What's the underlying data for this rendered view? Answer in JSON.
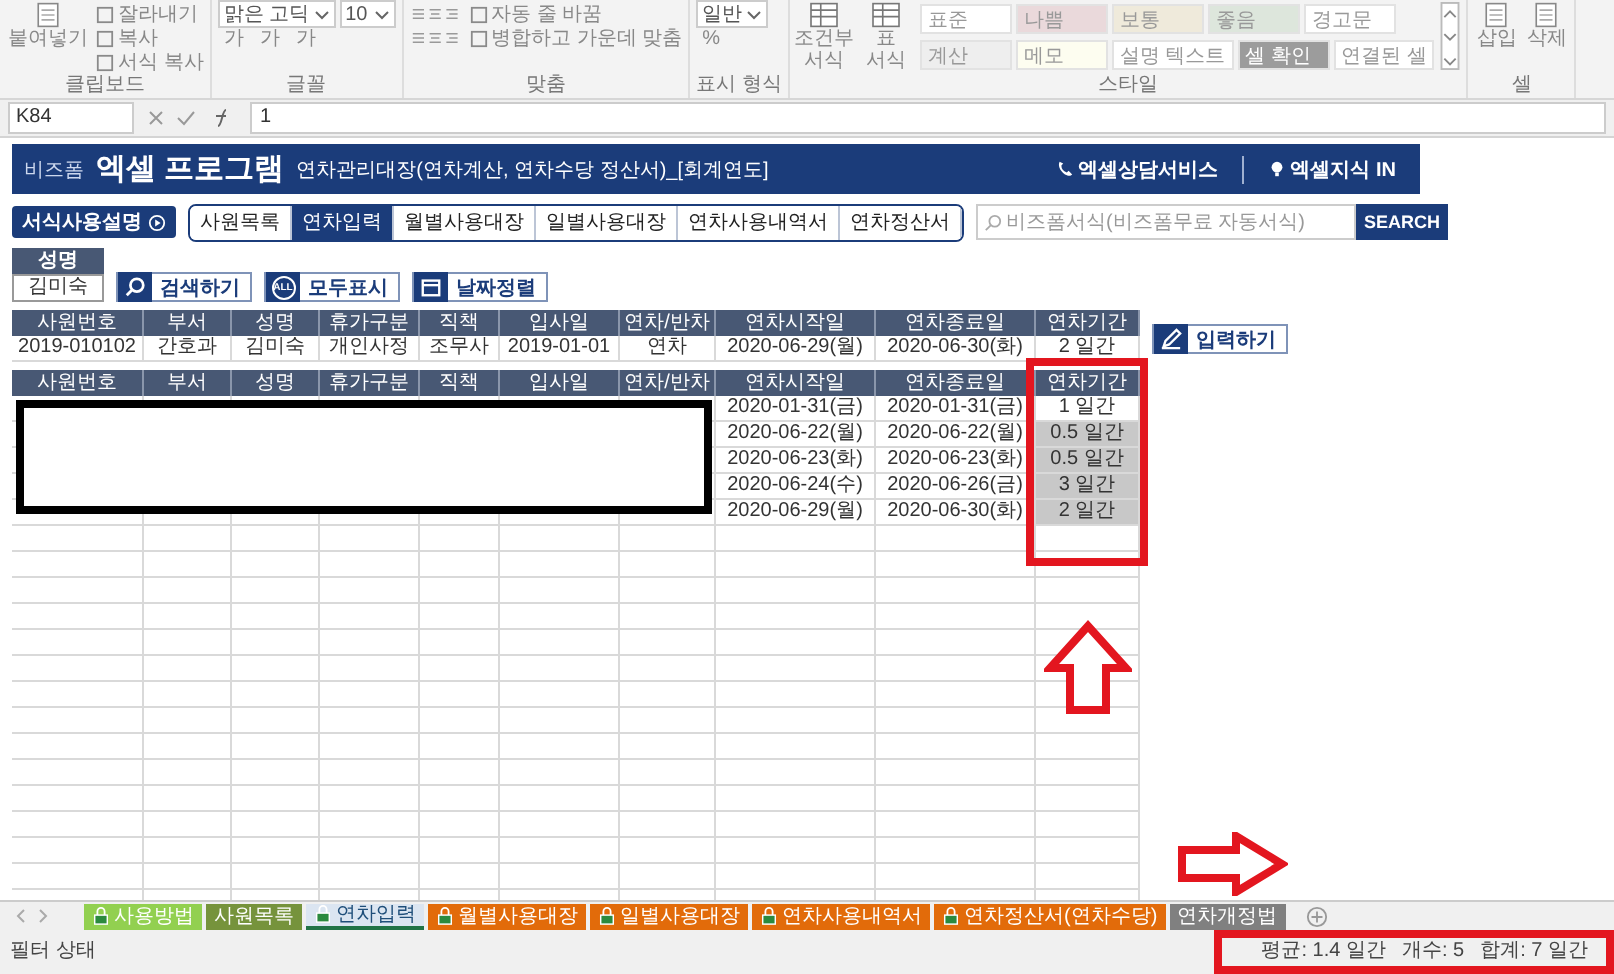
{
  "ribbon": {
    "groups": [
      {
        "label": "클립보드",
        "kind": "clipboard",
        "big": [
          "붙여넣기"
        ],
        "lines": [
          {
            "items": [
              {
                "text": "잘라내기",
                "kind": "text"
              }
            ]
          },
          {
            "items": [
              {
                "text": "복사",
                "kind": "text"
              }
            ]
          },
          {
            "items": [
              {
                "text": "서식 복사",
                "kind": "text"
              }
            ]
          }
        ]
      },
      {
        "label": "글꼴",
        "kind": "font",
        "lines": [
          {
            "items": [
              {
                "text": "맑은 고딕",
                "kind": "dropdown"
              },
              {
                "text": "10",
                "kind": "dropdown"
              }
            ]
          },
          {
            "items": [
              {
                "text": "가",
                "kind": "glyph"
              },
              {
                "text": "가",
                "kind": "glyph"
              },
              {
                "text": "가",
                "kind": "glyph"
              }
            ]
          }
        ]
      },
      {
        "label": "맞춤",
        "kind": "align",
        "lines": [
          {
            "items": [
              {
                "text": "자동 줄 바꿈",
                "kind": "text"
              }
            ]
          },
          {
            "items": [
              {
                "text": "병합하고 가운데 맞춤",
                "kind": "text"
              }
            ]
          }
        ]
      },
      {
        "label": "표시 형식",
        "kind": "number",
        "lines": [
          {
            "items": [
              {
                "text": "일반",
                "kind": "dropdown"
              }
            ]
          },
          {
            "items": [
              {
                "text": "%",
                "kind": "glyph"
              }
            ]
          }
        ]
      },
      {
        "label": "스타일",
        "kind": "styles",
        "big": [
          "조건부 서식",
          "표 서식"
        ],
        "lines": [
          {
            "items": [
              {
                "text": "표준",
                "kind": "style",
                "color": "#ffffff"
              },
              {
                "text": "나쁨",
                "kind": "style",
                "color": "#ead9db"
              },
              {
                "text": "보통",
                "kind": "style",
                "color": "#efeadb"
              },
              {
                "text": "좋음",
                "kind": "style",
                "color": "#dde6dc"
              },
              {
                "text": "경고문",
                "kind": "style",
                "color": "#ffffff"
              }
            ]
          },
          {
            "items": [
              {
                "text": "계산",
                "kind": "style",
                "color": "#eeeeee"
              },
              {
                "text": "메모",
                "kind": "style",
                "color": "#fdfdf0"
              },
              {
                "text": "설명 텍스트",
                "kind": "style",
                "color": "#ffffff"
              },
              {
                "text": "셀 확인",
                "kind": "style",
                "color": "#9c9c9c"
              },
              {
                "text": "연결된 셀",
                "kind": "style",
                "color": "#ffffff"
              }
            ]
          }
        ]
      },
      {
        "label": "셀",
        "kind": "cells",
        "big": [
          "삽입",
          "삭제"
        ]
      }
    ]
  },
  "formula_bar": {
    "cell": "K84",
    "value": "1"
  },
  "banner": {
    "logo": "비즈폼",
    "title": "엑셀 프로그램",
    "subtitle": "연차관리대장(연차계산, 연차수당 정산서)_[회계연도]",
    "links": [
      {
        "text": "엑셀상담서비스",
        "kind": "phone"
      },
      {
        "text": "엑셀지식 IN",
        "kind": "bulb"
      }
    ]
  },
  "help_button": "서식사용설명",
  "tabs": [
    {
      "label": "사원목록",
      "selected": false
    },
    {
      "label": "연차입력",
      "selected": true
    },
    {
      "label": "월별사용대장",
      "selected": false
    },
    {
      "label": "일별사용대장",
      "selected": false
    },
    {
      "label": "연차사용내역서",
      "selected": false
    },
    {
      "label": "연차정산서",
      "selected": false
    }
  ],
  "search": {
    "placeholder": "비즈폼서식(비즈폼무료 자동서식)",
    "button": "SEARCH"
  },
  "name_filter": {
    "label": "성명",
    "value": "김미숙"
  },
  "actions": [
    {
      "label": "검색하기",
      "kind": "search"
    },
    {
      "label": "모두표시",
      "kind": "all",
      "badge": "ALL"
    },
    {
      "label": "날짜정렬",
      "kind": "calendar"
    }
  ],
  "entry_table": {
    "columns": [
      "사원번호",
      "부서",
      "성명",
      "휴가구분",
      "직책",
      "입사일",
      "연차/반차",
      "연차시작일",
      "연차종료일",
      "연차기간"
    ],
    "row": [
      "2019-010102",
      "간호과",
      "김미숙",
      "개인사정",
      "조무사",
      "2019-01-01",
      "연차",
      "2020-06-29(월)",
      "2020-06-30(화)",
      "2 일간"
    ]
  },
  "input_button": "입력하기",
  "log_table": {
    "columns": [
      "사원번호",
      "부서",
      "성명",
      "휴가구분",
      "직책",
      "입사일",
      "연차/반차",
      "연차시작일",
      "연차종료일",
      "연차기간"
    ],
    "rows": [
      {
        "start": "2020-01-31(금)",
        "end": "2020-01-31(금)",
        "period": "1 일간",
        "selected": false
      },
      {
        "start": "2020-06-22(월)",
        "end": "2020-06-22(월)",
        "period": "0.5 일간",
        "selected": true
      },
      {
        "start": "2020-06-23(화)",
        "end": "2020-06-23(화)",
        "period": "0.5 일간",
        "selected": true
      },
      {
        "start": "2020-06-24(수)",
        "end": "2020-06-26(금)",
        "period": "3 일간",
        "selected": true
      },
      {
        "start": "2020-06-29(월)",
        "end": "2020-06-30(화)",
        "period": "2 일간",
        "selected": true
      }
    ]
  },
  "sheet_tabs": [
    {
      "label": "사용방법",
      "color": "#92d050",
      "locked": true,
      "selected": false
    },
    {
      "label": "사원목록",
      "color": "#76933c",
      "locked": false,
      "selected": false
    },
    {
      "label": "연차입력",
      "color": "#dbe5f1",
      "locked": true,
      "selected": true
    },
    {
      "label": "월별사용대장",
      "color": "#e26b0a",
      "locked": true,
      "selected": false
    },
    {
      "label": "일별사용대장",
      "color": "#e26b0a",
      "locked": true,
      "selected": false
    },
    {
      "label": "연차사용내역서",
      "color": "#e26b0a",
      "locked": true,
      "selected": false
    },
    {
      "label": "연차정산서(연차수당)",
      "color": "#e26b0a",
      "locked": true,
      "selected": false
    },
    {
      "label": "연차개정법",
      "color": "#808080",
      "locked": false,
      "selected": false
    }
  ],
  "status_bar": {
    "left": "필터 상태",
    "stats": [
      "평균: 1.4 일간",
      "개수: 5",
      "합계: 7 일간"
    ]
  }
}
